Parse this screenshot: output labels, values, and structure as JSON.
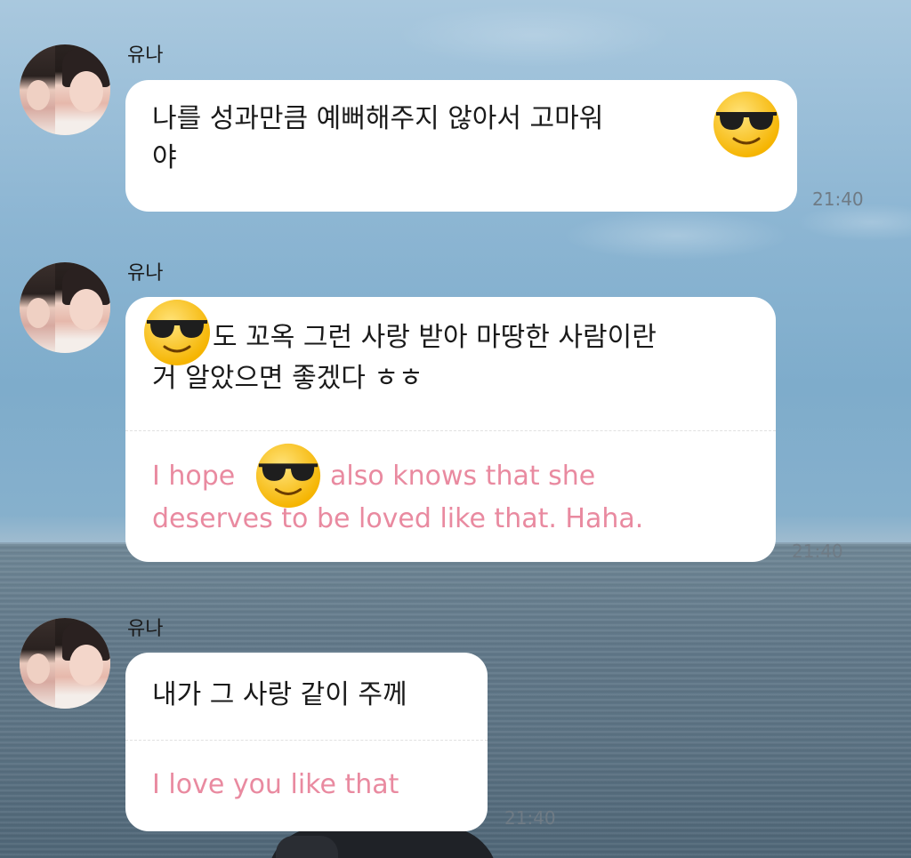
{
  "messages": [
    {
      "sender": "유나",
      "text_part1": "나를 성과만큼 예뻐해주지 않아서 고마워",
      "text_part2": "야",
      "emoji": "sunglasses-emoji",
      "time": "21:40"
    },
    {
      "sender": "유나",
      "text_part1": "도 꼬옥 그런 사랑 받아 마땅한 사람이란",
      "text_part2": "거 알았으면 좋겠다 ㅎㅎ",
      "translation_part1": "I hope",
      "translation_part2": "also knows that she",
      "translation_part3": "deserves to be loved like that. Haha.",
      "emoji": "sunglasses-emoji",
      "time": "21:40"
    },
    {
      "sender": "유나",
      "text": "내가 그 사랑 같이 주께",
      "translation": "I love you like that",
      "time": "21:40"
    }
  ],
  "colors": {
    "bubble": "#ffffff",
    "translation_text": "#e98aa0",
    "time_text": "#6f7b85"
  }
}
